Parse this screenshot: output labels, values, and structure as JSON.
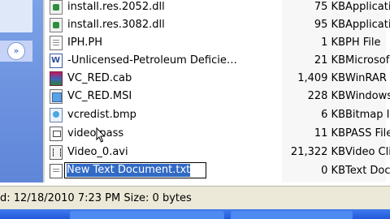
{
  "sidebar": {
    "expand_glyph": "»"
  },
  "files": [
    {
      "name": "install.res.2052.dll",
      "size": "75 KB",
      "type": "Applicatio",
      "icon": "dll-file-icon"
    },
    {
      "name": "install.res.3082.dll",
      "size": "95 KB",
      "type": "Applicatio",
      "icon": "dll-file-icon"
    },
    {
      "name": "IPH.PH",
      "size": "1 KB",
      "type": "PH File",
      "icon": "generic-file-icon"
    },
    {
      "name": "-Unlicensed-Petroleum Deficie…",
      "size": "21 KB",
      "type": "Microsof",
      "icon": "word-document-icon"
    },
    {
      "name": "VC_RED.cab",
      "size": "1,409 KB",
      "type": "WinRAR",
      "icon": "winrar-archive-icon"
    },
    {
      "name": "VC_RED.MSI",
      "size": "228 KB",
      "type": "Windows",
      "icon": "msi-installer-icon"
    },
    {
      "name": "vcredist.bmp",
      "size": "6 KB",
      "type": "Bitmap I",
      "icon": "bitmap-image-icon"
    },
    {
      "name": "video.pass",
      "size": "11 KB",
      "type": "PASS File",
      "icon": "pass-file-icon"
    },
    {
      "name": "Video_0.avi",
      "size": "21,322 KB",
      "type": "Video Clip",
      "icon": "video-clip-icon"
    }
  ],
  "renaming_file": {
    "edit_value": "New Text Document.txt",
    "size": "0 KB",
    "type": "Text Doc",
    "icon": "text-document-icon"
  },
  "statusbar": {
    "text": "d: 12/18/2010 7:23 PM Size: 0 bytes"
  },
  "colors": {
    "selection": "#316ac5",
    "statusbar": "#ece9d8",
    "taskbar": "#235ad8",
    "sidebar": "#6d93e0"
  }
}
